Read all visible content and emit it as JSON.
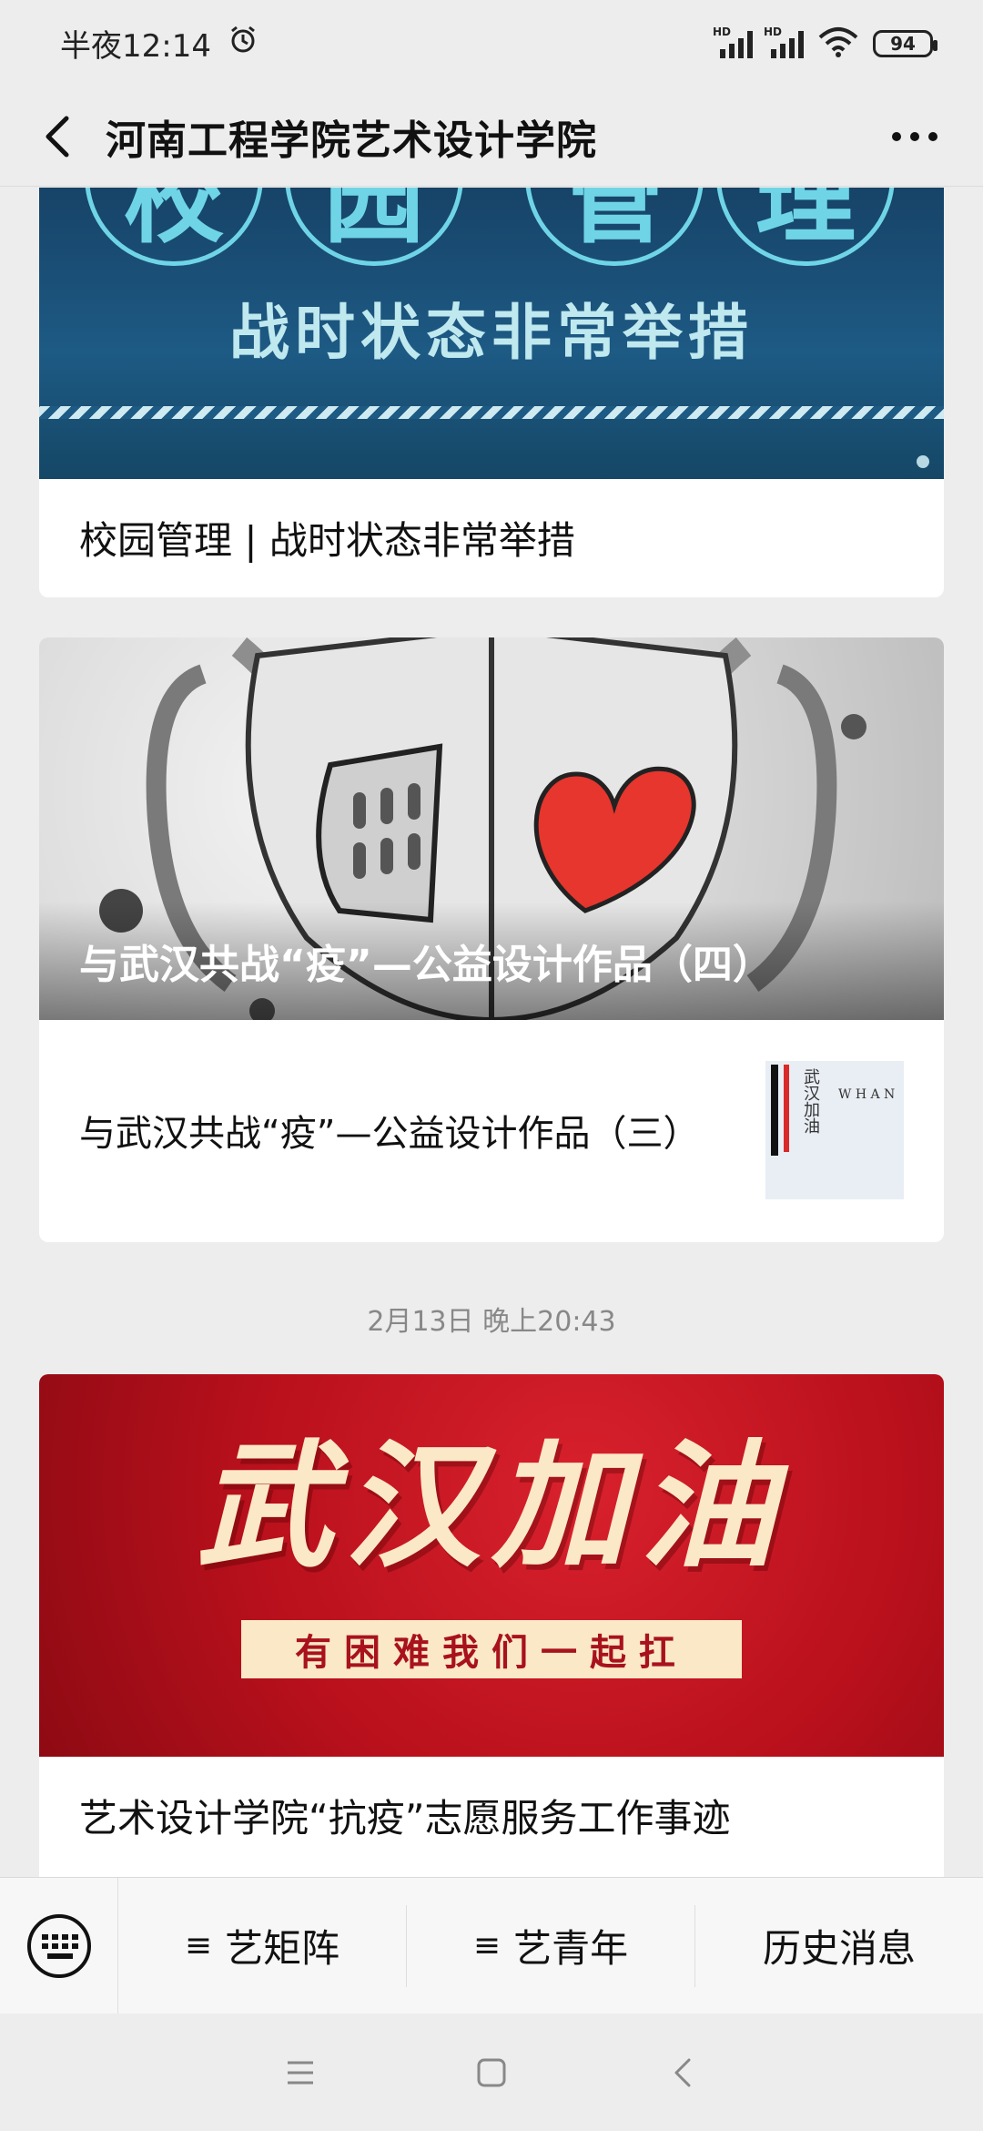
{
  "status_bar": {
    "time": "半夜12:14",
    "battery": "94",
    "signal_label_1": "HD",
    "signal_label_2": "HD"
  },
  "nav": {
    "title": "河南工程学院艺术设计学院"
  },
  "feed": {
    "item1": {
      "cover_chars": [
        "校",
        "园",
        "管",
        "理"
      ],
      "cover_banner": "战时状态非常举措",
      "title": "校园管理 | 战时状态非常举措"
    },
    "item2": {
      "cover_caption": "与武汉共战“疫”—公益设计作品（四）",
      "sub_title": "与武汉共战“疫”—公益设计作品（三）",
      "thumb_text": "武汉加油",
      "thumb_letters": "W H A N"
    },
    "timestamp": "2月13日 晚上20:43",
    "item3": {
      "cover_big": "武汉加油",
      "cover_ribbon": "有困难我们一起扛",
      "title": "艺术设计学院“抗疫”志愿服务工作事迹"
    }
  },
  "menu": {
    "items": [
      {
        "label": "艺矩阵",
        "icon": "hamburger-icon"
      },
      {
        "label": "艺青年",
        "icon": "hamburger-icon"
      },
      {
        "label": "历史消息"
      }
    ]
  },
  "colors": {
    "accent_red": "#b8101c",
    "accent_blue": "#1d5a84",
    "background": "#ededed"
  }
}
